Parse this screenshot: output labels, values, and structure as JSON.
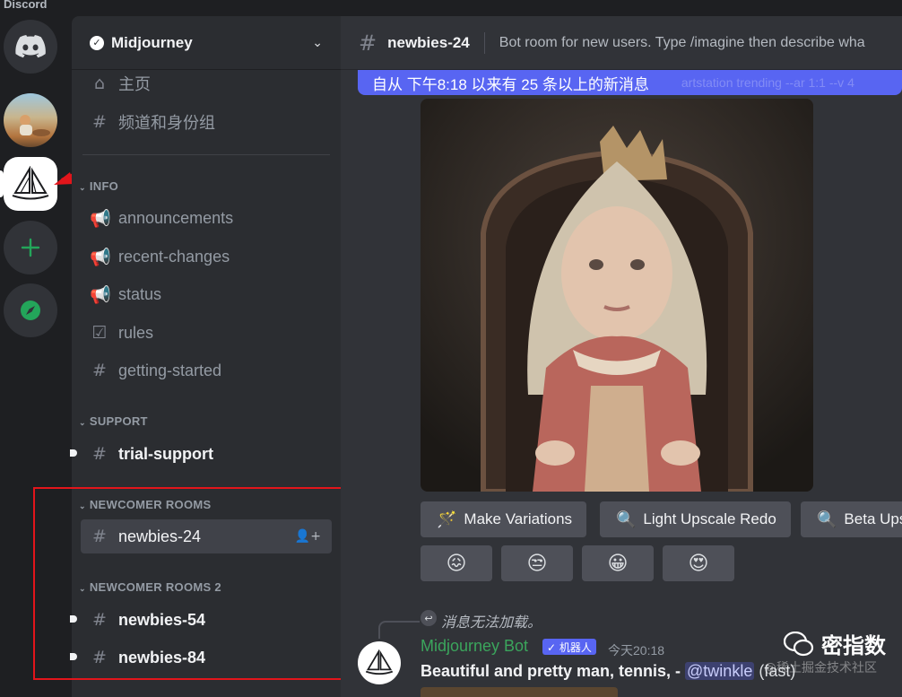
{
  "app": {
    "wordmark": "Discord"
  },
  "server": {
    "name": "Midjourney"
  },
  "sidebar": {
    "top_items": [
      {
        "label": "主页",
        "icon": "home-icon"
      },
      {
        "label": "频道和身份组",
        "icon": "channels-roles-icon"
      }
    ],
    "categories": {
      "info": {
        "label": "INFO",
        "channels": [
          {
            "label": "announcements",
            "icon": "megaphone-icon"
          },
          {
            "label": "recent-changes",
            "icon": "megaphone-icon"
          },
          {
            "label": "status",
            "icon": "megaphone-icon"
          },
          {
            "label": "rules",
            "icon": "checkbox-icon"
          },
          {
            "label": "getting-started",
            "icon": "hash-icon"
          }
        ]
      },
      "support": {
        "label": "SUPPORT",
        "channels": [
          {
            "label": "trial-support",
            "icon": "hash-icon",
            "unread": true
          }
        ]
      },
      "newcomer": {
        "label": "NEWCOMER ROOMS",
        "channels": [
          {
            "label": "newbies-24",
            "icon": "hash-thread-icon",
            "selected": true
          }
        ]
      },
      "newcomer2": {
        "label": "NEWCOMER ROOMS 2",
        "channels": [
          {
            "label": "newbies-54",
            "icon": "hash-thread-icon",
            "unread": true
          },
          {
            "label": "newbies-84",
            "icon": "hash-thread-icon",
            "unread": true
          }
        ]
      }
    }
  },
  "channel": {
    "name": "newbies-24",
    "topic": "Bot room for new users. Type /imagine then describe wha"
  },
  "new_messages_bar": {
    "text": "自从 下午8:18 以来有 25 条以上的新消息",
    "ghost_text": "artstation trending --ar 1:1 --v 4"
  },
  "buttons": {
    "make_variations": "Make Variations",
    "light_upscale_redo": "Light Upscale Redo",
    "beta_upscale": "Beta Ups"
  },
  "reactions": [
    "😖",
    "😒",
    "😀",
    "😍"
  ],
  "message": {
    "reply_text": "消息无法加载。",
    "author": "Midjourney Bot",
    "bot_tag": "✓ 机器人",
    "timestamp": "今天20:18",
    "content_prefix": "Beautiful and pretty man, tennis, - ",
    "mention": "@twinkle",
    "content_suffix": " (fast)"
  },
  "watermark": {
    "name": "密指数",
    "sub": "@稀土掘金技术社区"
  },
  "colors": {
    "blurple": "#5865f2",
    "green": "#3ba55c",
    "highlight_red": "#e2151b",
    "sidebar_bg": "#2b2d31",
    "main_bg": "#313338"
  }
}
